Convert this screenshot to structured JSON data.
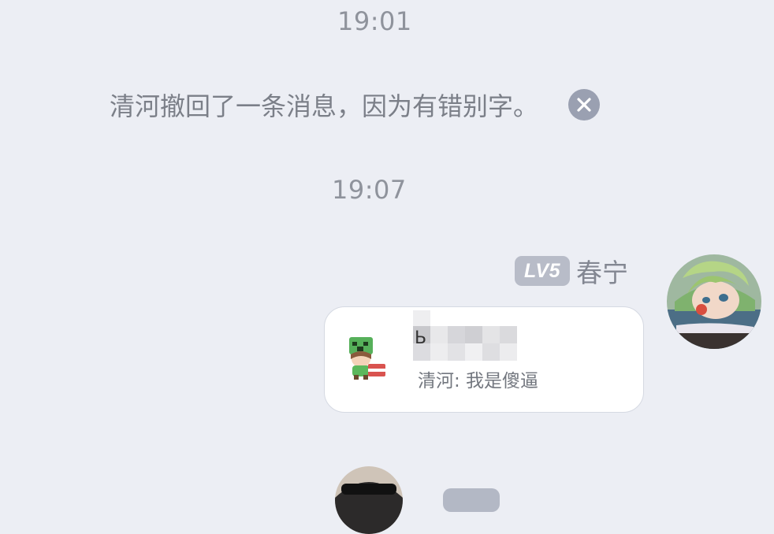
{
  "chat": {
    "timestamps": [
      "19:01",
      "19:07"
    ],
    "recall_notice": "清河撤回了一条消息，因为有错别字。",
    "sender": {
      "level_badge": "LV5",
      "name": "春宁"
    },
    "shared_card": {
      "title_visible_char": "Ь",
      "preview": "清河: 我是傻逼"
    }
  },
  "icons": {
    "dismiss": "close-icon",
    "card_sticker": "sticker-icon"
  },
  "colors": {
    "background": "#eceef4",
    "muted_text": "#8f939c",
    "badge": "#b8bcc8",
    "bubble": "#ffffff"
  }
}
